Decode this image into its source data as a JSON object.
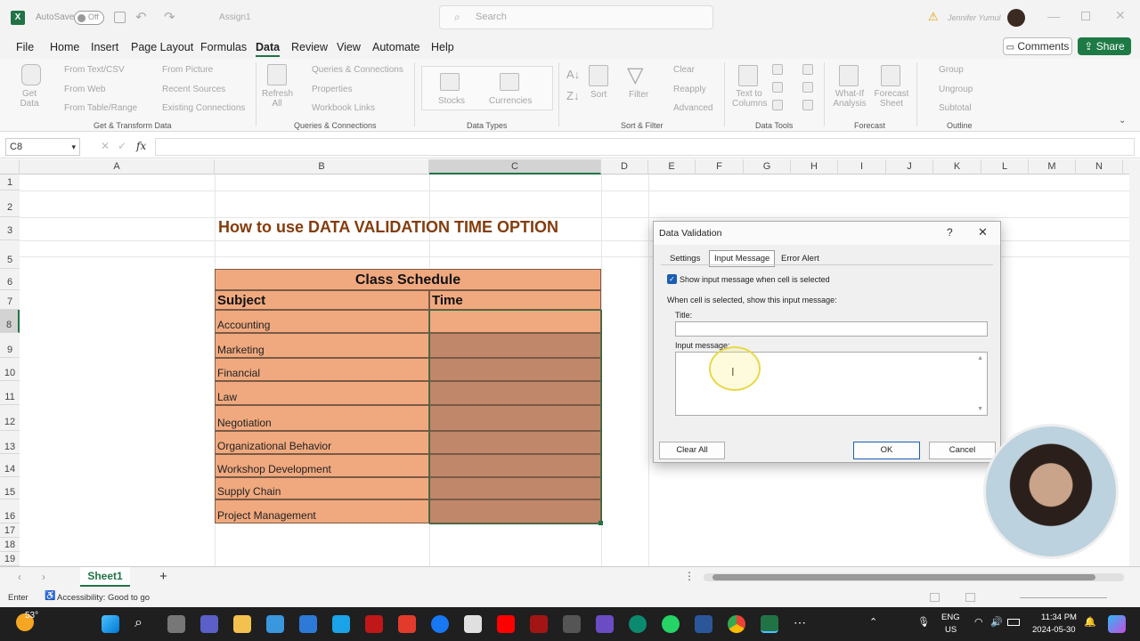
{
  "titlebar": {
    "autosave": "AutoSave",
    "toggle": "Off",
    "filename": "Assign1",
    "search_placeholder": "Search",
    "user": "Jennifer Yumul"
  },
  "menu": [
    "File",
    "Home",
    "Insert",
    "Page Layout",
    "Formulas",
    "Data",
    "Review",
    "View",
    "Automate",
    "Help"
  ],
  "buttons": {
    "comments": "Comments",
    "share": "Share"
  },
  "ribbon": {
    "get_data": "Get Data",
    "from_text": "From Text/CSV",
    "from_web": "From Web",
    "from_table": "From Table/Range",
    "from_picture": "From Picture",
    "recent_sources": "Recent Sources",
    "existing": "Existing Connections",
    "refresh": "Refresh All",
    "queries": "Queries & Connections",
    "properties": "Properties",
    "wb_links": "Workbook Links",
    "stocks": "Stocks",
    "currencies": "Currencies",
    "sort": "Sort",
    "filter": "Filter",
    "clear": "Clear",
    "reapply": "Reapply",
    "advanced": "Advanced",
    "text_cols": "Text to Columns",
    "whatif": "What-If Analysis",
    "forecast_sheet": "Forecast Sheet",
    "group": "Group",
    "ungroup": "Ungroup",
    "subtotal": "Subtotal",
    "groups": [
      "Get & Transform Data",
      "Queries & Connections",
      "Data Types",
      "Sort & Filter",
      "Data Tools",
      "Forecast",
      "Outline"
    ]
  },
  "namebox": "C8",
  "fx": "fx",
  "columns": [
    "A",
    "B",
    "C",
    "D",
    "E",
    "F",
    "G",
    "H",
    "I",
    "J",
    "K",
    "L",
    "M",
    "N"
  ],
  "rows": [
    "1",
    "2",
    "3",
    "5",
    "6",
    "7",
    "8",
    "9",
    "10",
    "11",
    "12",
    "13",
    "14",
    "15",
    "16",
    "17",
    "18",
    "19"
  ],
  "sheet": {
    "title": "How to use DATA VALIDATION TIME OPTION",
    "table_title": "Class Schedule",
    "header_subject": "Subject",
    "header_time": "Time",
    "subjects": [
      "Accounting",
      "Marketing",
      "Financial",
      "Law",
      "Negotiation",
      "Organizational Behavior",
      "Workshop Development",
      "Supply Chain",
      "Project Management"
    ]
  },
  "dialog": {
    "title": "Data Validation",
    "help": "?",
    "tabs": [
      "Settings",
      "Input Message",
      "Error Alert"
    ],
    "checkbox_label": "Show input message when cell is selected",
    "instruction": "When cell is selected, show this input message:",
    "title_label": "Title:",
    "title_value": "",
    "message_label": "Input message:",
    "message_value": "",
    "clear_all": "Clear All",
    "ok": "OK",
    "cancel": "Cancel"
  },
  "sheettab": "Sheet1",
  "status": {
    "mode": "Enter",
    "accessibility": "Accessibility: Good to go"
  },
  "taskbar": {
    "temp": "53°",
    "lang1": "ENG",
    "lang2": "US",
    "time": "11:34 PM",
    "date": "2024-05-30"
  },
  "colors": {
    "accent": "#217346",
    "table_fill": "#f0a97f",
    "time_fill": "#c0876a",
    "header_brown": "#843c0c"
  }
}
